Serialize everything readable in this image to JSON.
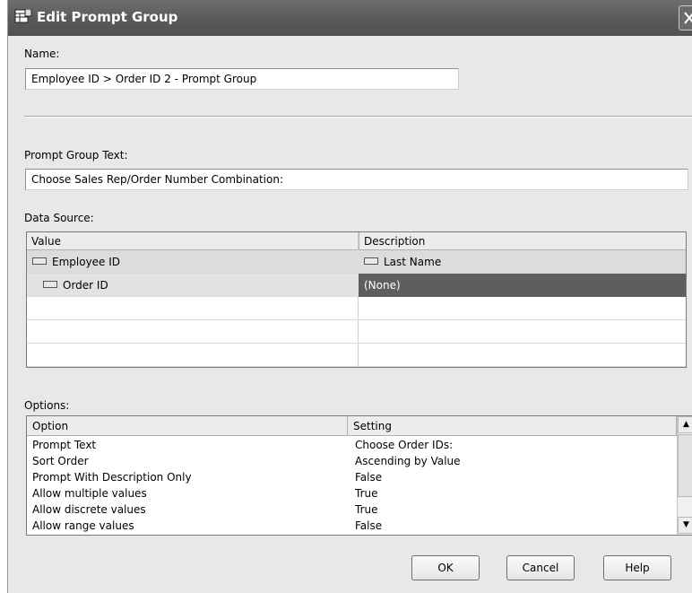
{
  "window": {
    "title": "Edit Prompt Group"
  },
  "name": {
    "label": "Name:",
    "value": "Employee ID > Order ID 2 - Prompt Group"
  },
  "prompt_group_text": {
    "label": "Prompt Group Text:",
    "value": "Choose Sales Rep/Order Number Combination:"
  },
  "data_source": {
    "label": "Data Source:",
    "columns": [
      "Value",
      "Description"
    ],
    "rows": [
      {
        "value": "Employee ID",
        "description": "Last Name"
      },
      {
        "value": "Order ID",
        "description": "(None)"
      }
    ]
  },
  "options": {
    "label": "Options:",
    "columns": [
      "Option",
      "Setting"
    ],
    "rows": [
      {
        "option": "Prompt Text",
        "setting": "Choose Order IDs:"
      },
      {
        "option": "Sort Order",
        "setting": "Ascending by Value"
      },
      {
        "option": "Prompt With Description Only",
        "setting": "False"
      },
      {
        "option": "Allow multiple values",
        "setting": "True"
      },
      {
        "option": "Allow discrete values",
        "setting": "True"
      },
      {
        "option": "Allow range values",
        "setting": "False"
      }
    ]
  },
  "buttons": {
    "ok": "OK",
    "cancel": "Cancel",
    "help": "Help"
  }
}
